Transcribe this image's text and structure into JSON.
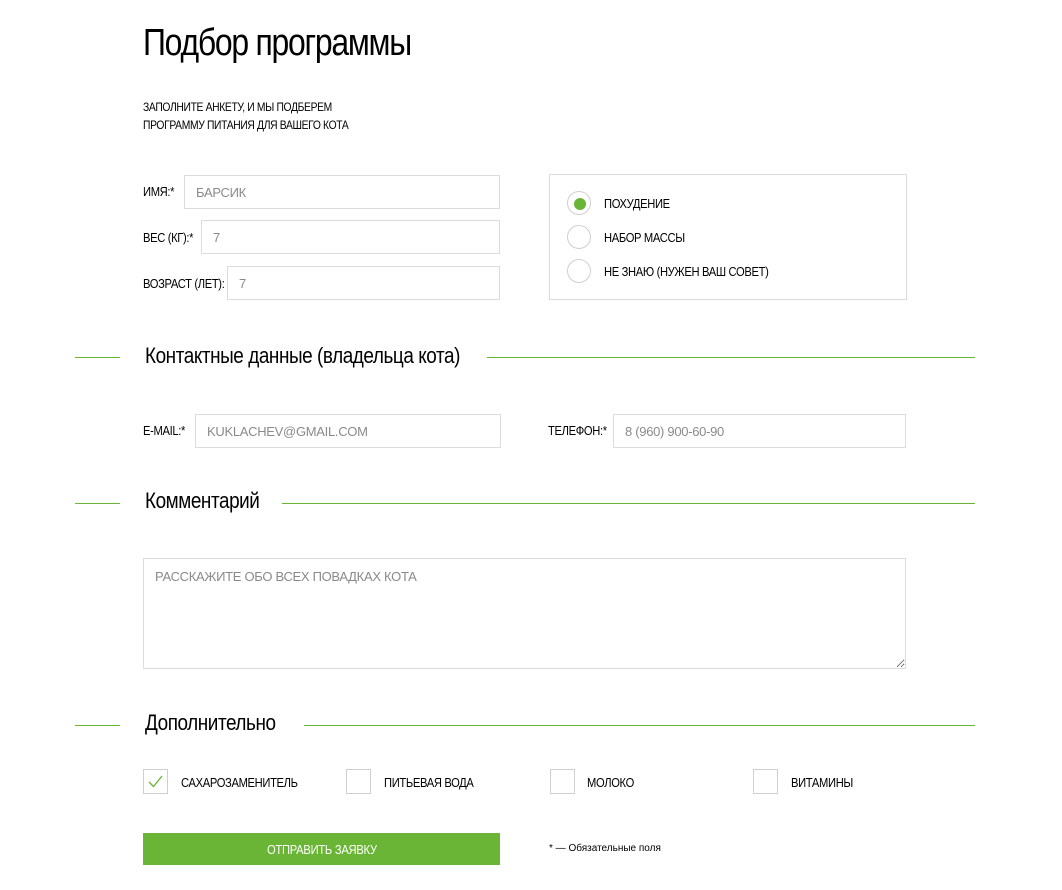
{
  "page": {
    "title": "Подбор программы",
    "subtitle_line1": "ЗАПОЛНИТЕ АНКЕТУ, И МЫ ПОДБЕРЕМ",
    "subtitle_line2": "ПРОГРАММУ ПИТАНИЯ ДЛЯ ВАШЕГО КОТА"
  },
  "colors": {
    "accent": "#6ab535",
    "border": "#dcdcdc",
    "text": "#000000",
    "placeholder": "#8a8a8a"
  },
  "cat": {
    "name": {
      "label": "ИМЯ:*",
      "placeholder": "БАРСИК"
    },
    "weight": {
      "label": "ВЕС (КГ):*",
      "placeholder": "7"
    },
    "age": {
      "label": "ВОЗРАСТ (ЛЕТ):",
      "placeholder": "7"
    }
  },
  "goal": {
    "selected_index": 0,
    "options": [
      {
        "label": "ПОХУДЕНИЕ",
        "selected": true
      },
      {
        "label": "НАБОР МАССЫ",
        "selected": false
      },
      {
        "label": "НЕ ЗНАЮ (НУЖЕН ВАШ СОВЕТ)",
        "selected": false
      }
    ]
  },
  "contacts": {
    "section_title": "Контактные данные (владельца кота)",
    "email": {
      "label": "E-MAIL:*",
      "placeholder": "KUKLACHEV@GMAIL.COM"
    },
    "phone": {
      "label": "ТЕЛЕФОН:*",
      "placeholder": "8 (960) 900-60-90"
    }
  },
  "comment": {
    "section_title": "Комментарий",
    "placeholder": "РАССКАЖИТЕ ОБО ВСЕХ ПОВАДКАХ КОТА"
  },
  "extras": {
    "section_title": "Дополнительно",
    "items": [
      {
        "label": "САХАРОЗАМЕНИТЕЛЬ",
        "checked": true
      },
      {
        "label": "ПИТЬЕВАЯ ВОДА",
        "checked": false
      },
      {
        "label": "МОЛОКО",
        "checked": false
      },
      {
        "label": "ВИТАМИНЫ",
        "checked": false
      }
    ]
  },
  "footer": {
    "submit_label": "ОТПРАВИТЬ ЗАЯВКУ",
    "required_note": "* — Обязательные поля"
  }
}
